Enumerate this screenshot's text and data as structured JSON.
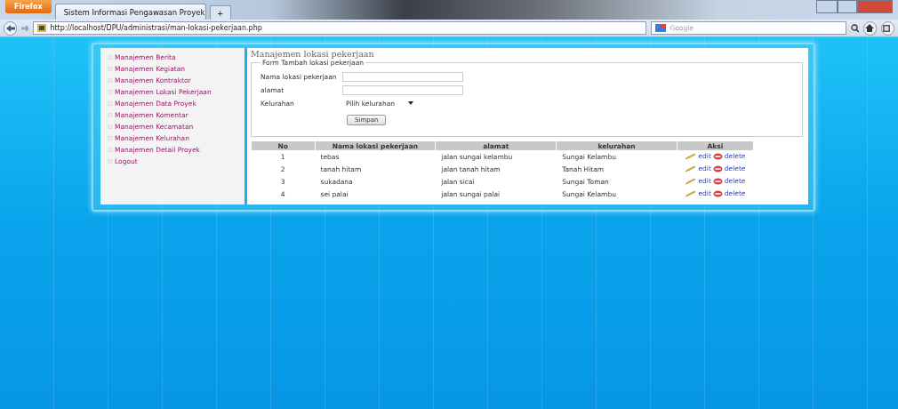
{
  "browser": {
    "menu_button": "Firefox",
    "tab_title": "Sistem Informasi Pengawasan Proyek",
    "new_tab": "+",
    "url": "http://localhost/DPU/administrasi/man-lokasi-pekerjaan.php",
    "search_placeholder": "Google"
  },
  "sidebar": {
    "items": [
      {
        "label": "Manajemen Berita"
      },
      {
        "label": "Manajemen Kegiatan"
      },
      {
        "label": "Manajemen Kontraktor"
      },
      {
        "label": "Manajemen Lokasi Pekerjaan"
      },
      {
        "label": "Manajemen Data Proyek"
      },
      {
        "label": "Manajemen Komentar"
      },
      {
        "label": "Manajemen Kecamatan"
      },
      {
        "label": "Manajemen Kelurahan"
      },
      {
        "label": "Manajemen Detail Proyek"
      },
      {
        "label": "Logout"
      }
    ]
  },
  "page_title": "Manajemen lokasi pekerjaan",
  "form": {
    "legend": "Form Tambah lokasi pekerjaan",
    "fields": [
      {
        "label": "Nama lokasi pekerjaan",
        "kind": "text"
      },
      {
        "label": "alamat",
        "kind": "text"
      },
      {
        "label": "Kelurahan",
        "kind": "select",
        "value": "Pilih kelurahan"
      }
    ],
    "submit": "Simpan"
  },
  "table": {
    "columns": [
      "No",
      "Nama lokasi pekerjaan",
      "alamat",
      "kelurahan",
      "Aksi"
    ],
    "rows": [
      {
        "no": "1",
        "nama": "tebas",
        "alamat": "jalan sungai kelambu",
        "kelurahan": "Sungai Kelambu",
        "edit": "edit",
        "delete": "delete"
      },
      {
        "no": "2",
        "nama": "tanah hitam",
        "alamat": "jalan tanah hitam",
        "kelurahan": "Tanah Hitam",
        "edit": "edit",
        "delete": "delete"
      },
      {
        "no": "3",
        "nama": "sukadana",
        "alamat": "jalan sicai",
        "kelurahan": "Sungai Toman",
        "edit": "edit",
        "delete": "delete"
      },
      {
        "no": "4",
        "nama": "sei palai",
        "alamat": "jalan sungai palai",
        "kelurahan": "Sungai Kelambu",
        "edit": "edit",
        "delete": "delete"
      }
    ]
  }
}
